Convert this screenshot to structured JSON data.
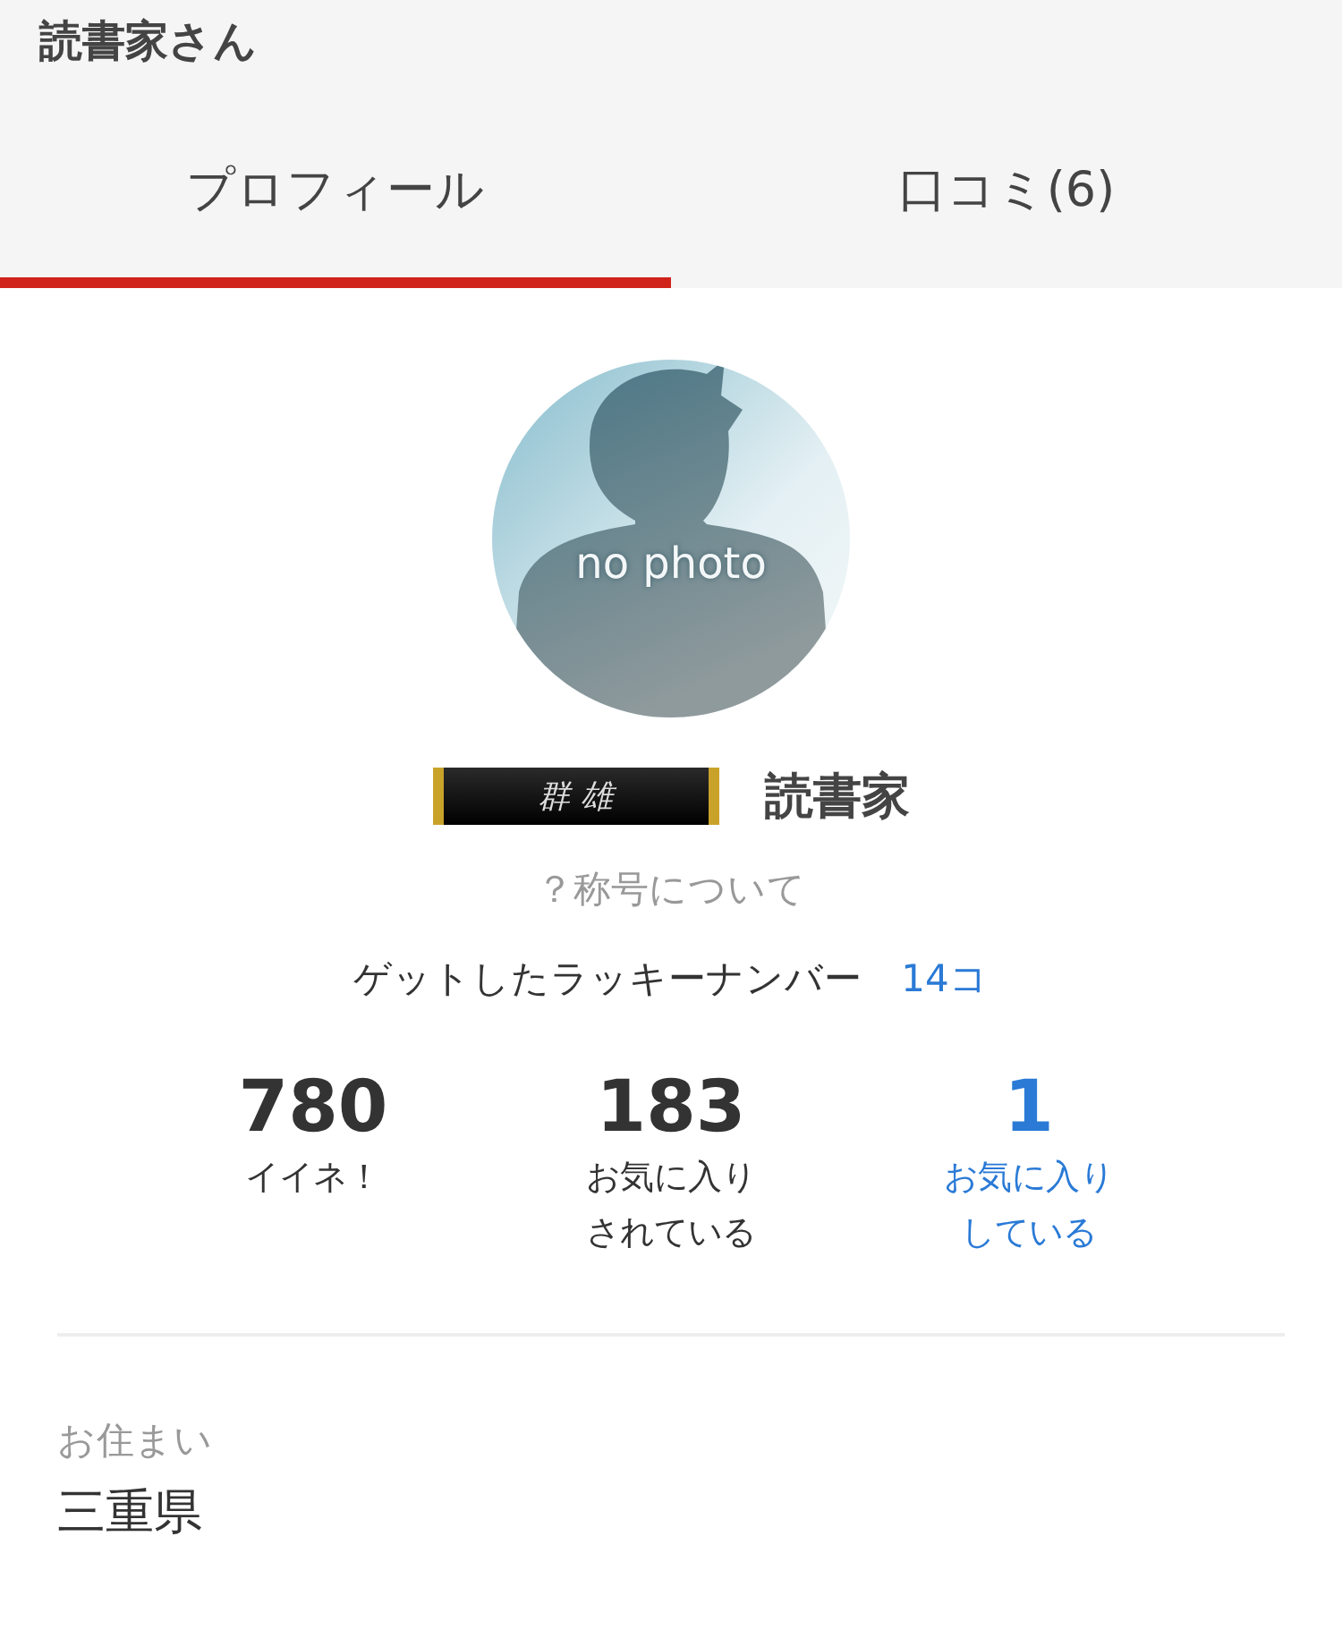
{
  "header": {
    "title": "読書家さん"
  },
  "tabs": [
    {
      "label": "プロフィール",
      "selected": true
    },
    {
      "label": "口コミ(6)",
      "selected": false
    }
  ],
  "profile": {
    "avatar_caption": "no photo",
    "rank_badge": "群 雄",
    "name": "読書家",
    "title_help": "？称号について",
    "lucky_label": "ゲットしたラッキーナンバー",
    "lucky_count": "14コ"
  },
  "stats": [
    {
      "value": "780",
      "label": [
        "イイネ！"
      ],
      "kind": "plain"
    },
    {
      "value": "183",
      "label": [
        "お気に入り",
        "されている"
      ],
      "kind": "plain"
    },
    {
      "value": "1",
      "label": [
        "お気に入り",
        "している"
      ],
      "kind": "link"
    }
  ],
  "residence": {
    "label": "お住まい",
    "value": "三重県"
  }
}
